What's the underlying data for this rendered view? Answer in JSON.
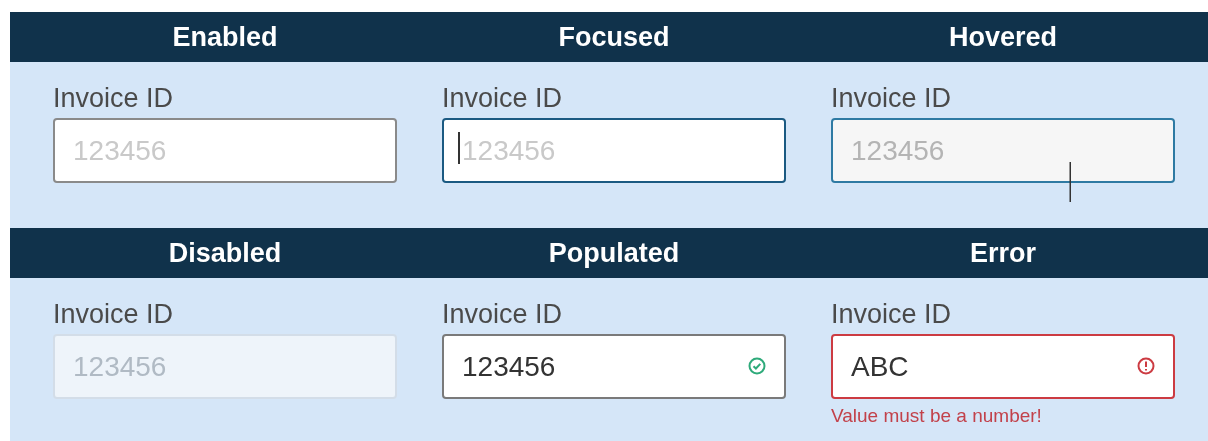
{
  "rows": [
    {
      "fields": [
        {
          "heading": "Enabled",
          "label": "Invoice ID",
          "placeholder": "123456",
          "kind": "enabled"
        },
        {
          "heading": "Focused",
          "label": "Invoice ID",
          "placeholder": "123456",
          "kind": "focused"
        },
        {
          "heading": "Hovered",
          "label": "Invoice ID",
          "placeholder": "123456",
          "kind": "hovered"
        }
      ]
    },
    {
      "fields": [
        {
          "heading": "Disabled",
          "label": "Invoice ID",
          "placeholder": "123456",
          "kind": "disabled"
        },
        {
          "heading": "Populated",
          "label": "Invoice ID",
          "value": "123456",
          "kind": "populated"
        },
        {
          "heading": "Error",
          "label": "Invoice ID",
          "value": "ABC",
          "kind": "error",
          "message": "Value must be a number!"
        }
      ]
    }
  ]
}
